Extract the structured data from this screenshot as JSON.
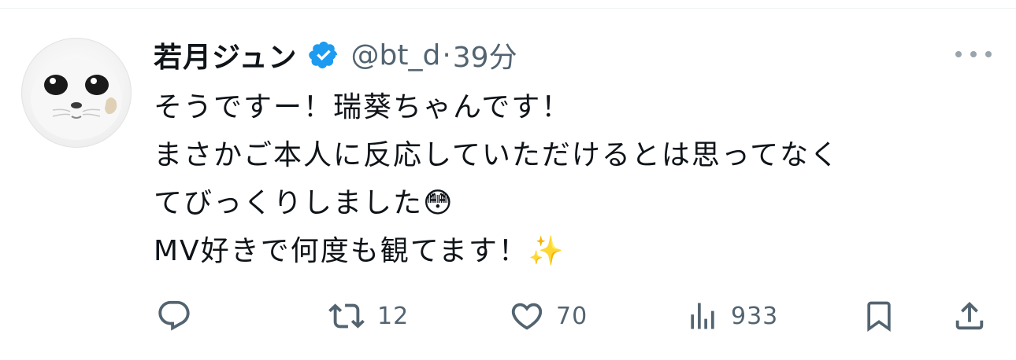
{
  "tweet": {
    "author": {
      "display_name": "若月ジュン",
      "handle": "@bt_d",
      "verified": true,
      "avatar_icon": "seal-avatar"
    },
    "separator": "·",
    "timestamp": "39分",
    "text_lines": [
      "そうですー！瑞葵ちゃんです！",
      "まさかご本人に反応していただけるとは思ってなく",
      "てびっくりしました😳",
      "MV好きで何度も観てます！✨"
    ]
  },
  "actions": {
    "reply": {
      "icon": "reply-icon",
      "count": ""
    },
    "retweet": {
      "icon": "retweet-icon",
      "count": "12"
    },
    "like": {
      "icon": "heart-icon",
      "count": "70"
    },
    "views": {
      "icon": "views-icon",
      "count": "933"
    },
    "bookmark": {
      "icon": "bookmark-icon"
    },
    "share": {
      "icon": "share-icon"
    }
  },
  "colors": {
    "text_primary": "#0f1419",
    "text_secondary": "#536471",
    "verified_badge": "#1d9bf0"
  }
}
